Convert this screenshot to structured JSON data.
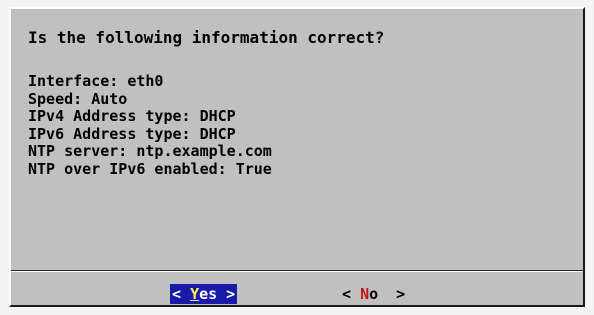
{
  "dialog": {
    "question": "Is the following information correct?",
    "info_lines": [
      "Interface: eth0",
      "Speed: Auto",
      "IPv4 Address type: DHCP",
      "IPv6 Address type: DHCP",
      "NTP server: ntp.example.com",
      "NTP over IPv6 enabled: True"
    ]
  },
  "buttons": {
    "yes": {
      "left": "< ",
      "hotkey": "Y",
      "rest": "es",
      "right": " >"
    },
    "no": {
      "left": "< ",
      "hotkey": "N",
      "rest": "o",
      "right": "  >"
    }
  },
  "colors": {
    "dialog_background": "#c0c0c0",
    "selected_button_background": "#1a1aa8",
    "selected_hotkey": "#ffff55",
    "unselected_hotkey": "#c01818"
  }
}
